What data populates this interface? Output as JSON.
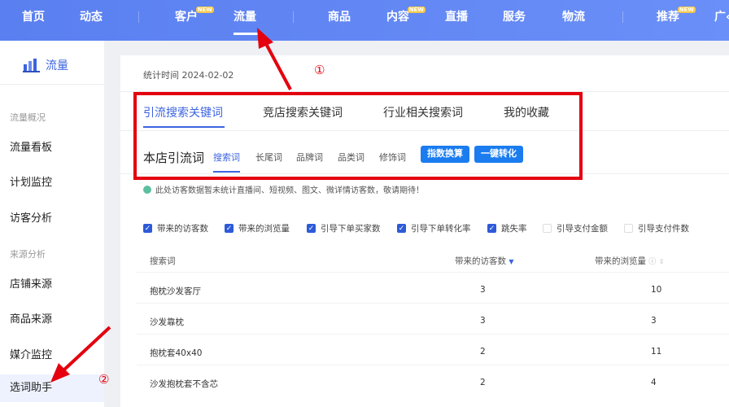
{
  "topnav": {
    "items": [
      {
        "label": "首页",
        "new": false
      },
      {
        "label": "动态",
        "new": false
      },
      {
        "label": "客户",
        "new": true
      },
      {
        "label": "流量",
        "new": false,
        "active": true
      },
      {
        "label": "商品",
        "new": false
      },
      {
        "label": "内容",
        "new": true
      },
      {
        "label": "直播",
        "new": false
      },
      {
        "label": "服务",
        "new": false
      },
      {
        "label": "物流",
        "new": false
      },
      {
        "label": "推荐",
        "new": true
      },
      {
        "label": "广‹",
        "new": false
      }
    ],
    "new_badge": "NEW"
  },
  "sidebar": {
    "title": "流量",
    "groups": [
      {
        "label": "流量概况",
        "items": [
          "流量看板",
          "计划监控",
          "访客分析"
        ]
      },
      {
        "label": "来源分析",
        "items": [
          "店铺来源",
          "商品来源",
          "媒介监控",
          "选词助手"
        ]
      }
    ],
    "active": "选词助手"
  },
  "main": {
    "stat_time": "统计时间 2024-02-02",
    "tabs": [
      "引流搜索关键词",
      "竞店搜索关键词",
      "行业相关搜索词",
      "我的收藏"
    ],
    "active_tab": "引流搜索关键词",
    "section_title": "本店引流词",
    "subtabs": [
      "搜索词",
      "长尾词",
      "品牌词",
      "品类词",
      "修饰词"
    ],
    "active_subtab": "搜索词",
    "buttons": {
      "index_convert": "指数换算",
      "one_click": "一键转化"
    },
    "notice": "此处访客数据暂未统计直播间、短视频、图文、微详情访客数，敬请期待！",
    "checkboxes": [
      {
        "label": "带来的访客数",
        "checked": true
      },
      {
        "label": "带来的浏览量",
        "checked": true
      },
      {
        "label": "引导下单买家数",
        "checked": true
      },
      {
        "label": "引导下单转化率",
        "checked": true
      },
      {
        "label": "跳失率",
        "checked": true
      },
      {
        "label": "引导支付金额",
        "checked": false
      },
      {
        "label": "引导支付件数",
        "checked": false
      }
    ],
    "table": {
      "columns": [
        "搜索词",
        "带来的访客数",
        "带来的浏览量"
      ],
      "rows": [
        [
          "抱枕沙发客厅",
          "3",
          "10"
        ],
        [
          "沙发靠枕",
          "3",
          "3"
        ],
        [
          "抱枕套40x40",
          "2",
          "11"
        ],
        [
          "沙发抱枕套不含芯",
          "2",
          "4"
        ]
      ]
    }
  },
  "annotations": {
    "marker1": "①",
    "marker2": "②",
    "color": "#e4000f"
  }
}
